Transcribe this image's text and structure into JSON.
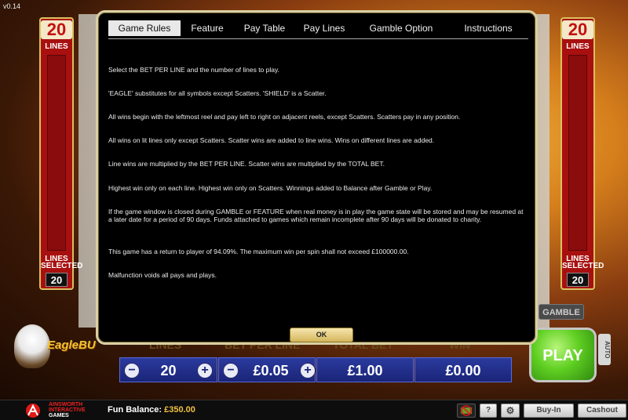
{
  "version": "v0.14",
  "lines_indicator": {
    "count": "20",
    "label": "LINES",
    "selected_label": "LINES SELECTED",
    "selected_value": "20"
  },
  "logo_text": "EagleBU",
  "bottom_labels": {
    "lines": "LINES",
    "bet_per_line": "BET PER LINE",
    "total_bet": "TOTAL BET",
    "win": "WIN"
  },
  "controls": {
    "lines_value": "20",
    "bet_per_line_value": "£0.05",
    "total_bet_value": "£1.00",
    "win_value": "£0.00",
    "minus_symbol": "−",
    "plus_symbol": "+"
  },
  "gamble_label": "GAMBLE",
  "play_label": "PLAY",
  "auto_label": "AUTO",
  "modal": {
    "tabs": [
      "Game Rules",
      "Feature",
      "Pay Table",
      "Pay Lines",
      "Gamble Option",
      "Instructions"
    ],
    "rules": [
      "Select the BET PER LINE and the number of lines to play.",
      "'EAGLE' substitutes for all symbols except Scatters. 'SHIELD' is a Scatter.",
      "All wins begin with the leftmost reel and pay left to right on adjacent reels, except Scatters. Scatters pay in any position.",
      "All wins on lit lines only except Scatters. Scatter wins are added to line wins. Wins on different lines are added.",
      "Line wins are multiplied by the BET PER LINE. Scatter wins are multiplied by the TOTAL BET.",
      "Highest win only on each line. Highest win only on Scatters. Winnings added to Balance after Gamble or Play.",
      "If the game window is closed during GAMBLE or FEATURE when real money is in play the game state will be stored and may be resumed at a later date for a period of 90 days. Funds attached to games which remain incomplete after 90 days will be donated to charity.",
      "This game has a return to player of 94.09%. The maximum win per spin shall not exceed £100000.00.",
      "Malfunction voids all pays and plays."
    ],
    "ok_label": "OK"
  },
  "footer": {
    "brand_line1": "AINSWORTH",
    "brand_line2": "INTERACTIVE",
    "brand_line3": "GAMES",
    "balance_label": "Fun Balance:",
    "balance_value": "£350.00",
    "help_label": "?",
    "buy_in_label": "Buy-In",
    "cashout_label": "Cashout"
  },
  "colors": {
    "modal_border": "#d9cfa4",
    "ok_button": "#e8d07a",
    "play_button": "#5fcf22",
    "control_blue": "#1a2578"
  }
}
